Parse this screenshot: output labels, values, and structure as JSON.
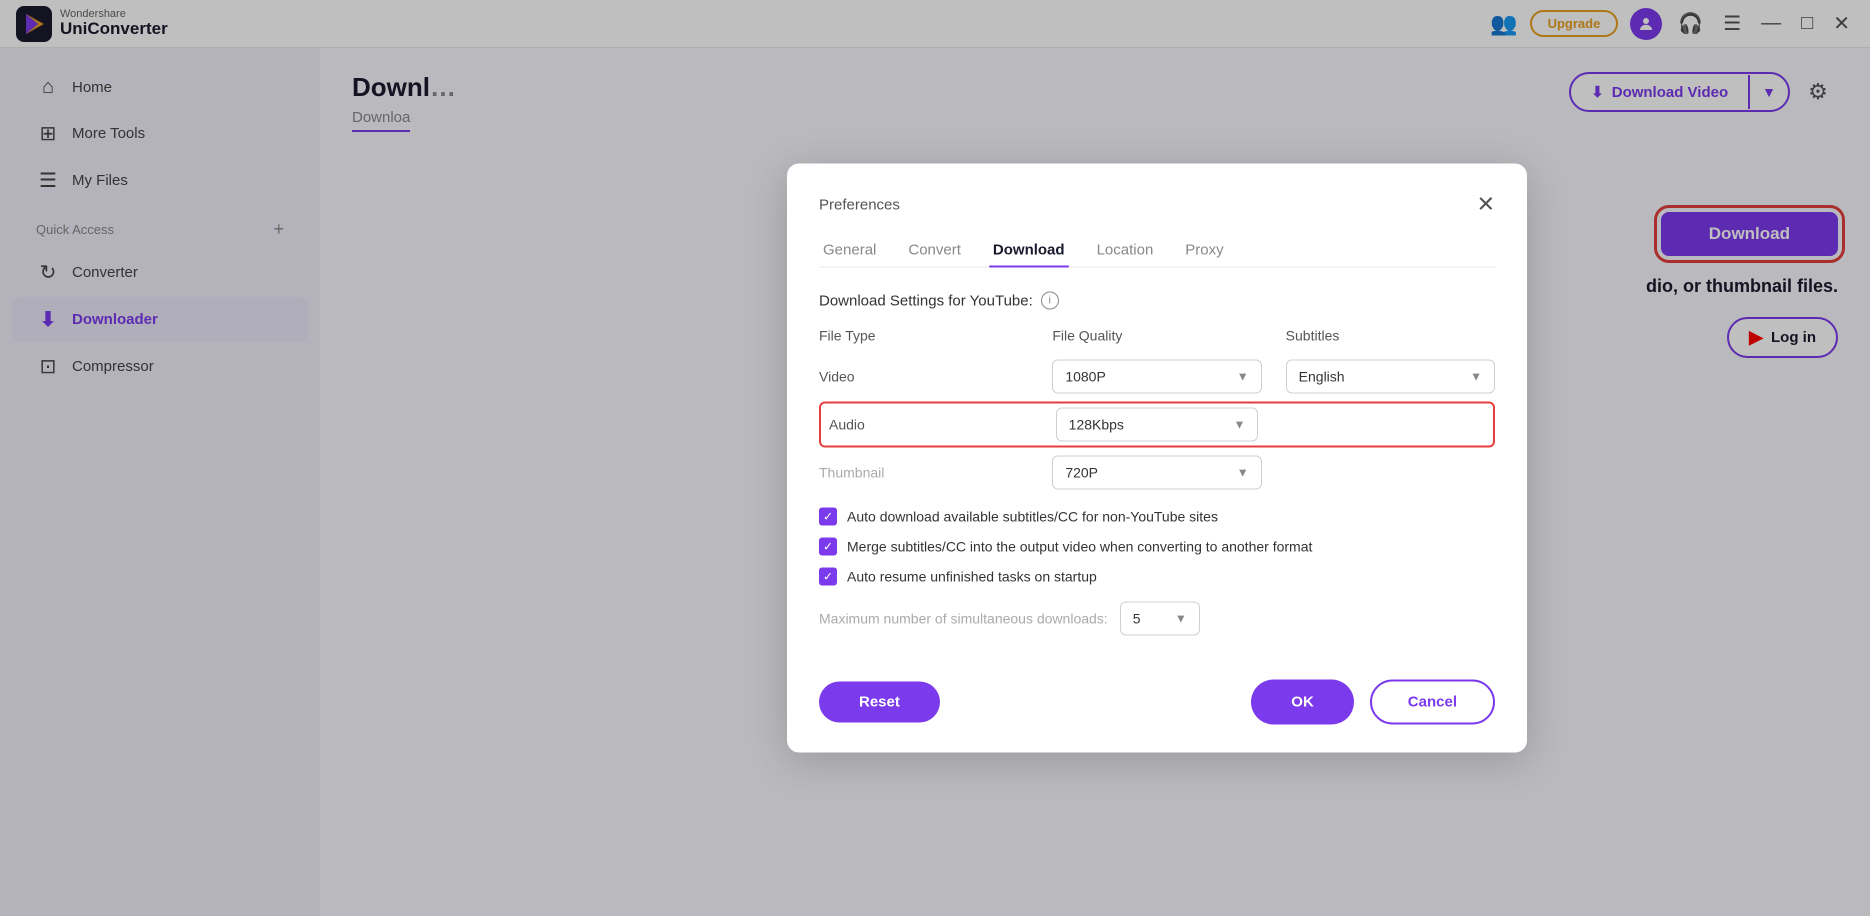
{
  "app": {
    "brand_small": "Wondershare",
    "brand_big": "UniConverter"
  },
  "titlebar": {
    "upgrade_label": "Upgrade",
    "min_icon": "—",
    "max_icon": "□",
    "close_icon": "✕"
  },
  "sidebar": {
    "items": [
      {
        "id": "home",
        "label": "Home",
        "icon": "⌂",
        "active": false
      },
      {
        "id": "more-tools",
        "label": "More Tools",
        "icon": "⊞",
        "active": false
      },
      {
        "id": "my-files",
        "label": "My Files",
        "icon": "☰",
        "active": false
      },
      {
        "id": "converter",
        "label": "Converter",
        "icon": "↻",
        "active": false
      },
      {
        "id": "downloader",
        "label": "Downloader",
        "icon": "⬇",
        "active": true
      },
      {
        "id": "compressor",
        "label": "Compressor",
        "icon": "⊡",
        "active": false
      }
    ],
    "quick_access": {
      "label": "Quick Access",
      "plus_label": "+"
    }
  },
  "main": {
    "page_title": "Downl",
    "page_subtitle": "Downloa",
    "download_video_btn": "Download Video",
    "download_btn": "Download",
    "center_text": "dio, or thumbnail files.",
    "login_btn": "Log in"
  },
  "modal": {
    "title": "Preferences",
    "close_icon": "✕",
    "tabs": [
      {
        "id": "general",
        "label": "General",
        "active": false
      },
      {
        "id": "convert",
        "label": "Convert",
        "active": false
      },
      {
        "id": "download",
        "label": "Download",
        "active": true
      },
      {
        "id": "location",
        "label": "Location",
        "active": false
      },
      {
        "id": "proxy",
        "label": "Proxy",
        "active": false
      }
    ],
    "section_title": "Download Settings for YouTube:",
    "info_icon": "i",
    "columns": {
      "file_type": "File Type",
      "file_quality": "File Quality",
      "subtitles": "Subtitles"
    },
    "rows": [
      {
        "type_label": "Video",
        "quality_value": "1080P",
        "subtitle_value": "English",
        "highlighted": false
      },
      {
        "type_label": "Audio",
        "quality_value": "128Kbps",
        "subtitle_value": "",
        "highlighted": true
      },
      {
        "type_label": "Thumbnail",
        "quality_value": "720P",
        "subtitle_value": "",
        "highlighted": false
      }
    ],
    "checkboxes": [
      {
        "id": "auto-subtitle",
        "label": "Auto download available subtitles/CC for non-YouTube sites",
        "checked": true
      },
      {
        "id": "merge-subtitle",
        "label": "Merge subtitles/CC into the output video when converting to another format",
        "checked": true
      },
      {
        "id": "auto-resume",
        "label": "Auto resume unfinished tasks on startup",
        "checked": true
      }
    ],
    "max_downloads": {
      "label": "Maximum number of simultaneous downloads:",
      "value": "5"
    },
    "footer": {
      "reset_label": "Reset",
      "ok_label": "OK",
      "cancel_label": "Cancel"
    }
  }
}
